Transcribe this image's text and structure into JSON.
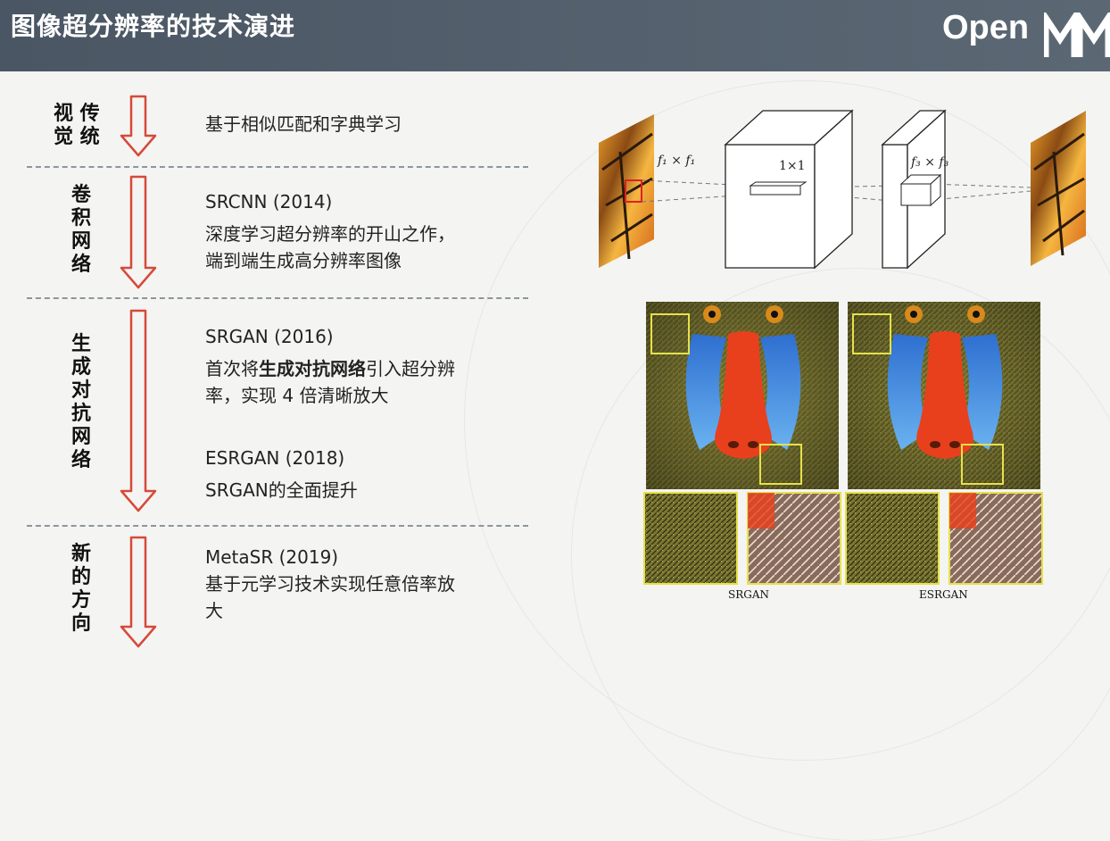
{
  "header": {
    "title": "图像超分辨率的技术演进",
    "logo_text": "Open"
  },
  "categories": [
    {
      "lines": [
        "视 传",
        "觉 统"
      ]
    },
    {
      "lines": [
        "卷",
        "积",
        "网",
        "络"
      ]
    },
    {
      "lines": [
        "生",
        "成",
        "对",
        "抗",
        "网",
        "络"
      ]
    },
    {
      "lines": [
        "新",
        "的",
        "方",
        "向"
      ]
    }
  ],
  "entries": {
    "traditional": "基于相似匹配和字典学习",
    "srcnn_title": "SRCNN (2014)",
    "srcnn_l1": "深度学习超分辨率的开山之作，",
    "srcnn_l2": "端到端生成高分辨率图像",
    "srgan_title": "SRGAN (2016)",
    "srgan_l1_pre": "首次将",
    "srgan_l1_bold": "生成对抗网络",
    "srgan_l1_post": "引入超分辨",
    "srgan_l2": "率，实现 4 倍清晰放大",
    "esrgan_title": "ESRGAN (2018)",
    "esrgan_l1": "SRGAN的全面提升",
    "metasr_title": "MetaSR (2019)",
    "metasr_l1": "基于元学习技术实现任意倍率放",
    "metasr_l2": "大"
  },
  "diagram": {
    "label1": "f₁ × f₁",
    "label2": "1×1",
    "label3": "f₃ × f₃"
  },
  "comparison": {
    "left_caption": "SRGAN",
    "right_caption": "ESRGAN"
  },
  "colors": {
    "header": "#4f5b67",
    "arrow": "#d64a3a",
    "separator": "#8c96a0",
    "highlight": "#e6e14a"
  }
}
